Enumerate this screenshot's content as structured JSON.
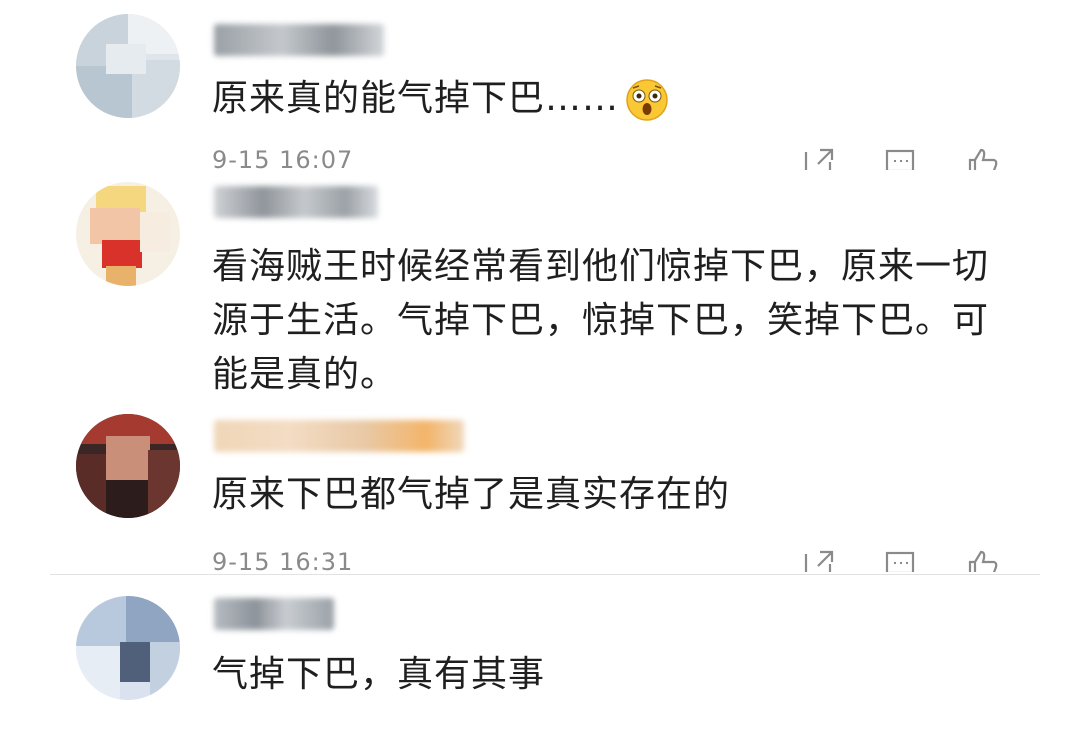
{
  "comments": [
    {
      "text": "原来真的能气掉下巴……",
      "emoji": "astonished-face",
      "time": "9-15 16:07"
    },
    {
      "text": "看海贼王时候经常看到他们惊掉下巴，原来一切源于生活。气掉下巴，惊掉下巴，笑掉下巴。可能是真的。"
    },
    {
      "text": "原来下巴都气掉了是真实存在的",
      "time": "9-15 16:31"
    },
    {
      "text": "气掉下巴，真有其事"
    }
  ],
  "icons": [
    "share-icon",
    "comment-icon",
    "like-icon"
  ],
  "colors": {
    "meta_gray": "#8a8a8a",
    "divider": "#e2e2e2",
    "text": "#1f1f1f"
  }
}
